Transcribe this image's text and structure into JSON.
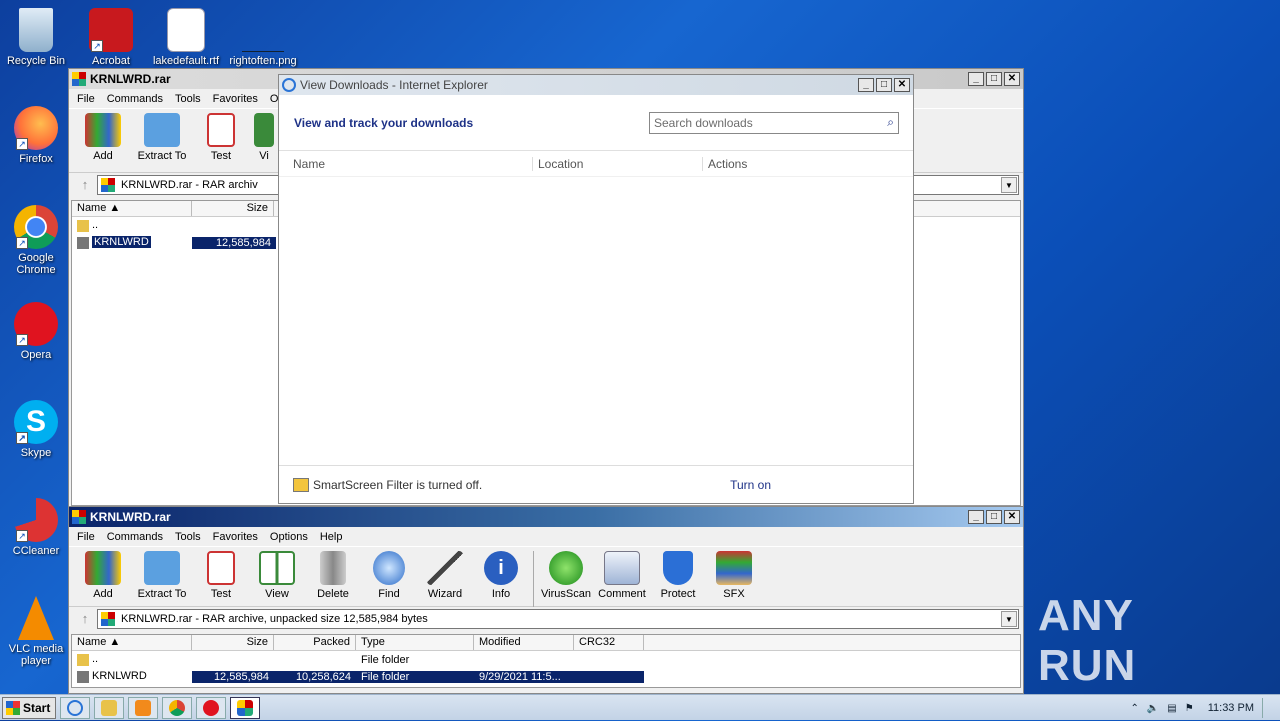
{
  "desktop": {
    "icons": [
      {
        "label": "Recycle Bin"
      },
      {
        "label": "Acrobat"
      },
      {
        "label": "lakedefault.rtf"
      },
      {
        "label": "rightoften.png"
      },
      {
        "label": "Firefox"
      },
      {
        "label": "Google Chrome"
      },
      {
        "label": "Opera"
      },
      {
        "label": "Skype"
      },
      {
        "label": "CCleaner"
      },
      {
        "label": "VLC media player"
      }
    ]
  },
  "winrar_back": {
    "title": "KRNLWRD.rar",
    "menu": [
      "File",
      "Commands",
      "Tools",
      "Favorites",
      "Op"
    ],
    "toolbar": [
      "Add",
      "Extract To",
      "Test",
      "Vi"
    ],
    "path": "KRNLWRD.rar - RAR archiv",
    "columns": [
      "Name",
      "Size"
    ],
    "rows": [
      {
        "name": "..",
        "size": ""
      },
      {
        "name": "KRNLWRD",
        "size": "12,585,984"
      }
    ]
  },
  "ie": {
    "title": "View Downloads - Internet Explorer",
    "heading": "View and track your downloads",
    "search_placeholder": "Search downloads",
    "columns": [
      "Name",
      "Location",
      "Actions"
    ],
    "smartscreen": "SmartScreen Filter is turned off.",
    "turn_on": "Turn on"
  },
  "winrar_front": {
    "title": "KRNLWRD.rar",
    "menu": [
      "File",
      "Commands",
      "Tools",
      "Favorites",
      "Options",
      "Help"
    ],
    "toolbar": [
      "Add",
      "Extract To",
      "Test",
      "View",
      "Delete",
      "Find",
      "Wizard",
      "Info",
      "VirusScan",
      "Comment",
      "Protect",
      "SFX"
    ],
    "path": "KRNLWRD.rar - RAR archive, unpacked size 12,585,984 bytes",
    "columns": [
      "Name",
      "Size",
      "Packed",
      "Type",
      "Modified",
      "CRC32"
    ],
    "rows": [
      {
        "name": "..",
        "size": "",
        "packed": "",
        "type": "File folder",
        "modified": "",
        "crc": ""
      },
      {
        "name": "KRNLWRD",
        "size": "12,585,984",
        "packed": "10,258,624",
        "type": "File folder",
        "modified": "9/29/2021 11:5...",
        "crc": ""
      }
    ]
  },
  "taskbar": {
    "start": "Start",
    "clock": "11:33 PM"
  },
  "watermark": "ANY RUN"
}
